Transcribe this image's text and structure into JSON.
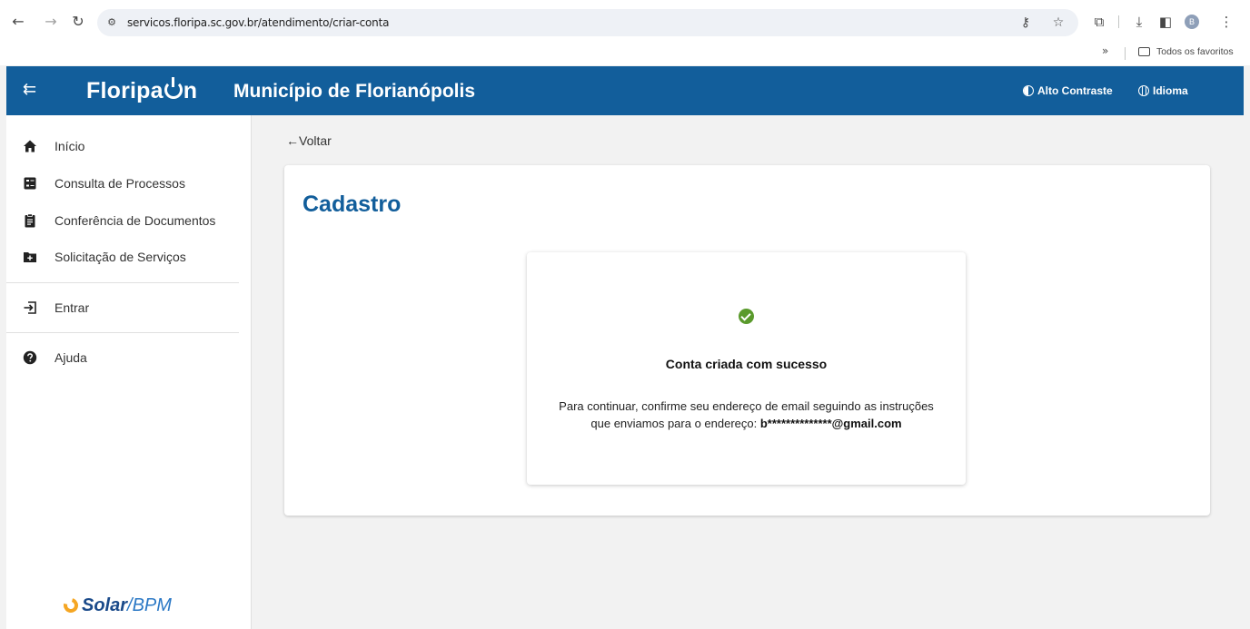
{
  "browser": {
    "url": "servicos.floripa.sc.gov.br/atendimento/criar-conta",
    "avatar_letter": "B",
    "bookmarks_label": "Todos os favoritos"
  },
  "header": {
    "logo_left": "Floripa",
    "logo_right": "n",
    "municipio": "Município de Florianópolis",
    "alto_contraste": "Alto Contraste",
    "idioma": "Idioma"
  },
  "sidebar": {
    "items": [
      {
        "label": "Início",
        "icon": "home-icon"
      },
      {
        "label": "Consulta de Processos",
        "icon": "list-icon"
      },
      {
        "label": "Conferência de Documentos",
        "icon": "clipboard-icon"
      },
      {
        "label": "Solicitação de Serviços",
        "icon": "folder-plus-icon"
      },
      {
        "label": "Entrar",
        "icon": "login-icon"
      },
      {
        "label": "Ajuda",
        "icon": "help-icon"
      }
    ],
    "footer_brand_1": "Solar",
    "footer_brand_2": "/BPM"
  },
  "main": {
    "back_label": "←Voltar",
    "title": "Cadastro",
    "success_title": "Conta criada com sucesso",
    "message_line1": "Para continuar, confirme seu endereço de email seguindo as instruções",
    "message_line2_prefix": "que enviamos para o endereço: ",
    "email": "b**************@gmail.com"
  },
  "colors": {
    "brand_blue": "#125e9b",
    "success_green": "#5a9a2c"
  }
}
